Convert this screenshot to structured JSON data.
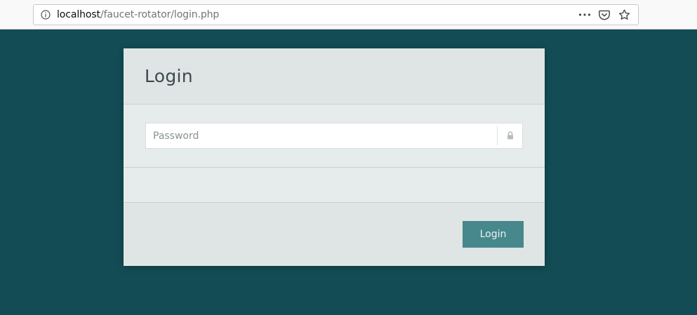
{
  "browser": {
    "url_host": "localhost",
    "url_path": "/faucet-rotator/login.php",
    "icons": [
      "info-icon",
      "more-icon",
      "pocket-icon",
      "bookmark-star-icon"
    ]
  },
  "login": {
    "title": "Login",
    "password_placeholder": "Password",
    "password_value": "",
    "addon_icon": "lock-icon",
    "submit_label": "Login"
  },
  "colors": {
    "page_background": "#134c55",
    "panel_background": "#e6ecec",
    "button_background": "#46888c"
  }
}
